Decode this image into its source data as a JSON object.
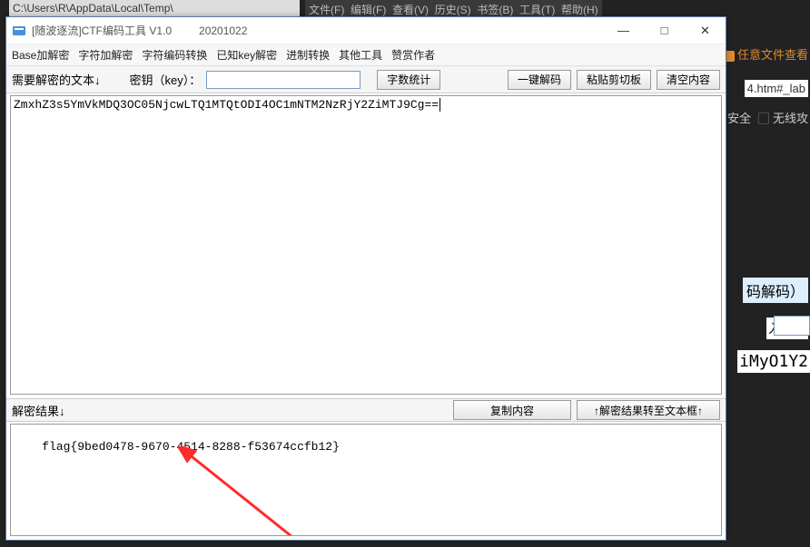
{
  "background": {
    "editor_path": "C:\\Users\\R\\AppData\\Local\\Temp\\",
    "editor_menus": [
      "文件(F)",
      "编辑(F)",
      "查看(V)",
      "历史(S)",
      "书签(B)",
      "工具(T)",
      "帮助(H)"
    ],
    "browser_tab": "任意文件查看",
    "browser_address_fragment": "4.htm#_lab",
    "browser_bookmarks": [
      "安全",
      "无线攻"
    ],
    "side_text1": "码解码）",
    "side_text2": "入一：",
    "side_text3": "iMyO1Y2"
  },
  "window": {
    "title": "[随波逐流]CTF编码工具 V1.0",
    "date": "20201022",
    "controls": {
      "minimize": "—",
      "maximize": "□",
      "close": "✕"
    }
  },
  "menubar": {
    "items": [
      "Base加解密",
      "字符加解密",
      "字符编码转换",
      "已知key解密",
      "进制转换",
      "其他工具",
      "赞赏作者"
    ]
  },
  "toolbar": {
    "input_label": "需要解密的文本↓",
    "key_label": "密钥（key）：",
    "key_value": "",
    "btn_charcount": "字数统计",
    "btn_decode": "一键解码",
    "btn_paste": "粘贴剪切板",
    "btn_clear": "清空内容"
  },
  "input_text": "ZmxhZ3s5YmVkMDQ3OC05NjcwLTQ1MTQtODI4OC1mNTM2NzRjY2ZiMTJ9Cg==",
  "result_header": {
    "label": "解密结果↓",
    "btn_copy": "复制内容",
    "btn_toinput": "↑解密结果转至文本框↑"
  },
  "result_text": "flag{9bed0478-9670-4514-8288-f53674ccfb12}"
}
